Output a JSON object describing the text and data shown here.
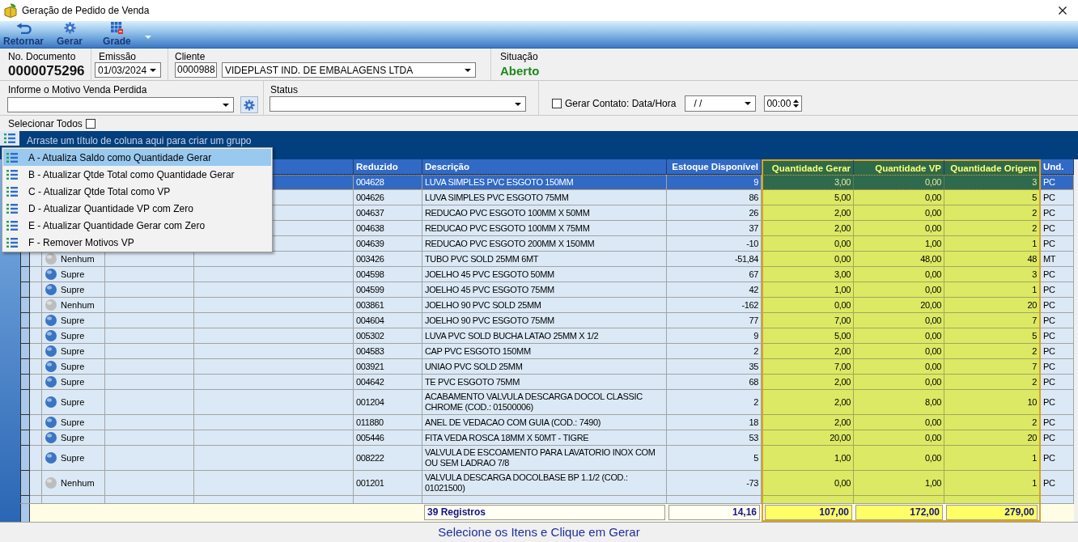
{
  "window": {
    "title": "Geração de Pedido de Venda"
  },
  "toolbar": {
    "buttons": [
      {
        "label": "Retornar",
        "kind": "back"
      },
      {
        "label": "Gerar",
        "kind": "gear"
      },
      {
        "label": "Grade",
        "kind": "grid"
      }
    ]
  },
  "header": {
    "documento": {
      "label": "No. Documento",
      "value": "0000075296"
    },
    "emissao": {
      "label": "Emissão",
      "value": "01/03/2024"
    },
    "cliente": {
      "label": "Cliente",
      "code": "0000988",
      "name": "VIDEPLAST IND. DE EMBALAGENS LTDA"
    },
    "situacao": {
      "label": "Situação",
      "value": "Aberto"
    }
  },
  "motivo": {
    "label": "Informe o Motivo Venda Perdida"
  },
  "status_filter": {
    "label": "Status"
  },
  "contato": {
    "label": "Gerar Contato: Data/Hora",
    "checked": false,
    "date": "/ /",
    "time": "00:00"
  },
  "select_all": {
    "label": "Selecionar Todos",
    "checked": false
  },
  "group_panel": {
    "hint": "Arraste um título de coluna aqui para criar um grupo"
  },
  "table": {
    "columns": [
      {
        "label": "Reduzido",
        "kind": "text",
        "highlighted": false
      },
      {
        "label": "Descrição",
        "kind": "text",
        "highlighted": false
      },
      {
        "label": "Estoque Disponível",
        "kind": "number",
        "highlighted": false
      },
      {
        "label": "Quantidade Gerar",
        "kind": "number",
        "highlighted": true
      },
      {
        "label": "Quantidade VP",
        "kind": "number",
        "highlighted": true
      },
      {
        "label": "Quantidade Origem",
        "kind": "number",
        "highlighted": true
      },
      {
        "label": "Und.",
        "kind": "text",
        "highlighted": false
      }
    ],
    "rows": [
      {
        "selected": true,
        "cells": [
          "004628",
          "LUVA SIMPLES PVC ESGOTO 150MM",
          "9",
          "3,00",
          "0,00",
          "3",
          "PC"
        ]
      },
      {
        "selected": false,
        "cells": [
          "004626",
          "LUVA SIMPLES PVC ESGOTO 75MM",
          "86",
          "5,00",
          "0,00",
          "5",
          "PC"
        ]
      },
      {
        "selected": false,
        "cells": [
          "004637",
          "REDUCAO PVC ESGOTO 100MM X 50MM",
          "26",
          "2,00",
          "0,00",
          "2",
          "PC"
        ]
      },
      {
        "selected": false,
        "cells": [
          "004638",
          "REDUCAO PVC ESGOTO 100MM X 75MM",
          "37",
          "2,00",
          "0,00",
          "2",
          "PC"
        ]
      },
      {
        "selected": false,
        "cells": [
          "004639",
          "REDUCAO PVC ESGOTO 200MM X 150MM",
          "-10",
          "0,00",
          "1,00",
          "1",
          "PC"
        ]
      },
      {
        "selected": false,
        "status": {
          "label": "Nenhum",
          "color": "#bdbdbd"
        },
        "cells": [
          "003426",
          "TUBO PVC SOLD 25MM 6MT",
          "-51,84",
          "0,00",
          "48,00",
          "48",
          "MT"
        ]
      },
      {
        "selected": false,
        "status": {
          "label": "Supre",
          "color": "#3a74c4"
        },
        "cells": [
          "004598",
          "JOELHO 45 PVC ESGOTO 50MM",
          "67",
          "3,00",
          "0,00",
          "3",
          "PC"
        ]
      },
      {
        "selected": false,
        "status": {
          "label": "Supre",
          "color": "#3a74c4"
        },
        "cells": [
          "004599",
          "JOELHO 45 PVC ESGOTO 75MM",
          "42",
          "1,00",
          "0,00",
          "1",
          "PC"
        ]
      },
      {
        "selected": false,
        "status": {
          "label": "Nenhum",
          "color": "#bdbdbd"
        },
        "cells": [
          "003861",
          "JOELHO 90 PVC SOLD 25MM",
          "-162",
          "0,00",
          "20,00",
          "20",
          "PC"
        ]
      },
      {
        "selected": false,
        "status": {
          "label": "Supre",
          "color": "#3a74c4"
        },
        "cells": [
          "004604",
          "JOELHO 90 PVC ESGOTO 75MM",
          "77",
          "7,00",
          "0,00",
          "7",
          "PC"
        ]
      },
      {
        "selected": false,
        "status": {
          "label": "Supre",
          "color": "#3a74c4"
        },
        "cells": [
          "005302",
          "LUVA PVC SOLD BUCHA LATAO 25MM X 1/2",
          "9",
          "5,00",
          "0,00",
          "5",
          "PC"
        ]
      },
      {
        "selected": false,
        "status": {
          "label": "Supre",
          "color": "#3a74c4"
        },
        "cells": [
          "004583",
          "CAP PVC ESGOTO 150MM",
          "2",
          "2,00",
          "0,00",
          "2",
          "PC"
        ]
      },
      {
        "selected": false,
        "status": {
          "label": "Supre",
          "color": "#3a74c4"
        },
        "cells": [
          "003921",
          "UNIAO PVC SOLD 25MM",
          "35",
          "7,00",
          "0,00",
          "7",
          "PC"
        ]
      },
      {
        "selected": false,
        "status": {
          "label": "Supre",
          "color": "#3a74c4"
        },
        "cells": [
          "004642",
          "TE PVC ESGOTO 75MM",
          "68",
          "2,00",
          "0,00",
          "2",
          "PC"
        ]
      },
      {
        "selected": false,
        "status": {
          "label": "Supre",
          "color": "#3a74c4"
        },
        "cells": [
          "001204",
          "ACABAMENTO VALVULA DESCARGA DOCOL CLASSIC CHROME (COD.: 01500006)",
          "2",
          "2,00",
          "8,00",
          "10",
          "PC"
        ]
      },
      {
        "selected": false,
        "status": {
          "label": "Supre",
          "color": "#3a74c4"
        },
        "cells": [
          "011880",
          "ANEL DE VEDACAO COM GUIA (COD.: 7490)",
          "18",
          "2,00",
          "0,00",
          "2",
          "PC"
        ]
      },
      {
        "selected": false,
        "status": {
          "label": "Supre",
          "color": "#3a74c4"
        },
        "cells": [
          "005446",
          "FITA VEDA ROSCA 18MM X 50MT - TIGRE",
          "53",
          "20,00",
          "0,00",
          "20",
          "PC"
        ]
      },
      {
        "selected": false,
        "status": {
          "label": "Supre",
          "color": "#3a74c4"
        },
        "cells": [
          "008222",
          "VALVULA DE ESCOAMENTO PARA LAVATORIO INOX COM OU SEM LADRAO 7/8",
          "5",
          "1,00",
          "0,00",
          "1",
          "PC"
        ]
      },
      {
        "selected": false,
        "status": {
          "label": "Nenhum",
          "color": "#bdbdbd"
        },
        "cells": [
          "001201",
          "VALVULA DESCARGA DOCOLBASE BP 1.1/2 (COD.: 01021500)",
          "-73",
          "0,00",
          "1,00",
          "1",
          "PC"
        ]
      }
    ],
    "footer": {
      "count": "39 Registros",
      "totals": [
        "14,16",
        "107,00",
        "172,00",
        "279,00"
      ]
    }
  },
  "context_menu": {
    "items": [
      {
        "label": "A - Atualiza Saldo como Quantidade Gerar",
        "selected": true
      },
      {
        "label": "B - Atualizar Qtde Total como Quantidade Gerar",
        "selected": false
      },
      {
        "label": "C - Atualizar Qtde Total como VP",
        "selected": false
      },
      {
        "label": "D - Atualizar Quantidade VP com Zero",
        "selected": false
      },
      {
        "label": "E - Atualizar Quantidade Gerar com Zero",
        "selected": false
      },
      {
        "label": "F - Remover Motivos VP",
        "selected": false
      }
    ]
  },
  "status_bar": {
    "text": "Selecione os Itens e Clique em Gerar"
  }
}
